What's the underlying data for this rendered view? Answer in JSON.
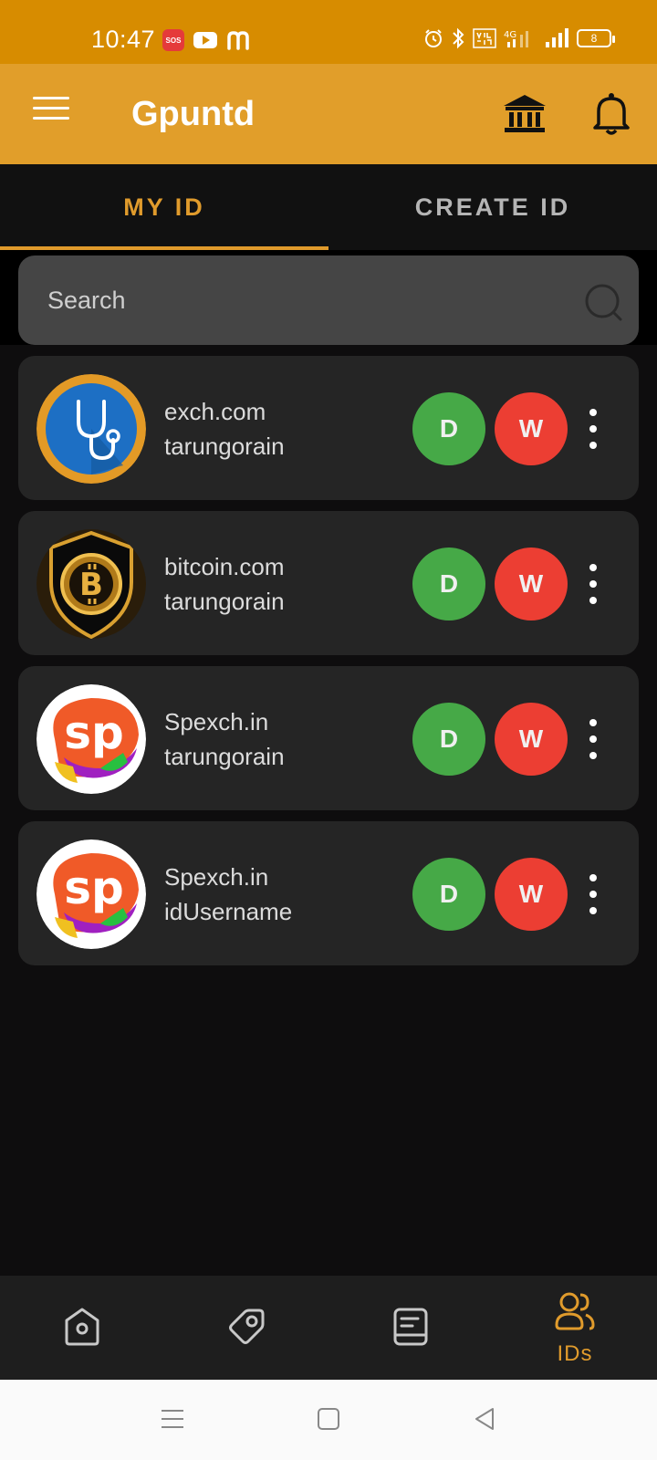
{
  "status_bar": {
    "time": "10:47",
    "sos": "SOS",
    "battery": "8"
  },
  "app_bar": {
    "title": "Gpuntd"
  },
  "tabs": [
    {
      "label": "MY ID",
      "active": true
    },
    {
      "label": "CREATE ID",
      "active": false
    }
  ],
  "search": {
    "placeholder": "Search",
    "value": ""
  },
  "ids": [
    {
      "site": "exch.com",
      "username": "tarungorain",
      "logo": "stethoscope-logo",
      "deposit_label": "D",
      "withdraw_label": "W"
    },
    {
      "site": "bitcoin.com",
      "username": "tarungorain",
      "logo": "bitcoin-shield-logo",
      "deposit_label": "D",
      "withdraw_label": "W"
    },
    {
      "site": "Spexch.in",
      "username": "tarungorain",
      "logo": "spexch-logo",
      "deposit_label": "D",
      "withdraw_label": "W"
    },
    {
      "site": "Spexch.in",
      "username": "idUsername",
      "logo": "spexch-logo",
      "deposit_label": "D",
      "withdraw_label": "W"
    }
  ],
  "bottom_nav": {
    "items": [
      {
        "icon": "home-icon"
      },
      {
        "icon": "tag-icon"
      },
      {
        "icon": "passbook-icon"
      },
      {
        "icon": "users-icon",
        "label": "IDs",
        "active": true
      }
    ]
  },
  "colors": {
    "status_bar": "#d78c00",
    "app_bar": "#e19e2a",
    "accent": "#e09b2c",
    "deposit": "#46a947",
    "withdraw": "#ec3e33"
  }
}
